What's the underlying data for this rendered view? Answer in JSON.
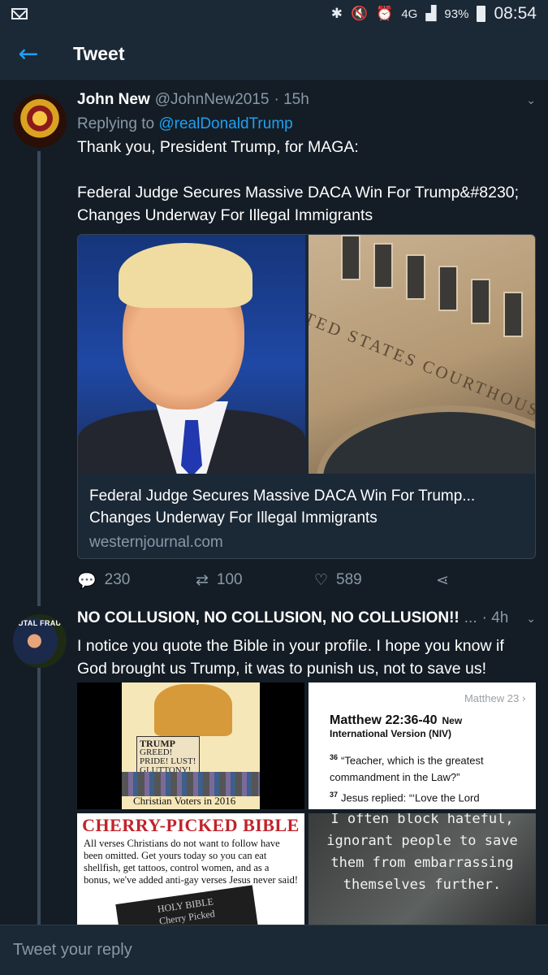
{
  "status_bar": {
    "network": "4G",
    "battery": "93%",
    "time": "08:54"
  },
  "app_bar": {
    "title": "Tweet"
  },
  "main_tweet": {
    "name": "John New",
    "handle": "@JohnNew2015",
    "time": "· 15h",
    "replying_prefix": "Replying to",
    "replying_to": "@realDonaldTrump",
    "text": "Thank you, President Trump, for MAGA:\n\nFederal Judge Secures Massive DACA Win For Trump&#8230; Changes Underway For Illegal Immigrants",
    "card": {
      "image_left_alt": "Donald Trump portrait",
      "image_right_text": "TED STATES COURTHOUSE",
      "title": "Federal Judge Secures Massive DACA Win For Trump... Changes Underway For Illegal Immigrants",
      "domain": "westernjournal.com"
    },
    "actions": {
      "replies": "230",
      "retweets": "100",
      "likes": "589"
    }
  },
  "reply_tweet": {
    "avatar_text": "UTAL FRAU",
    "name": "NO COLLUSION, NO COLLUSION, NO COLLUSION!!",
    "handle_trunc": "...",
    "time": "· 4h",
    "text": "I notice you quote the Bible in your profile. I hope you know if God brought us Trump, it was to punish us, not to save us!",
    "media": {
      "cartoon": {
        "plaque_title": "TRUMP",
        "plaque_text": "GREED! PRIDE! LUST! GLUTTONY!",
        "caption": "Christian Voters in 2016"
      },
      "bible": {
        "nav_label": "Matthew 23",
        "title": "Matthew 22:36-40",
        "title_tag": "New",
        "version": "International Version (NIV)",
        "v36_num": "36",
        "v36_text": "“Teacher, which is the greatest commandment in the Law?”",
        "v37_num": "37",
        "v37_text": "Jesus replied: “‘Love the Lord"
      },
      "cherry": {
        "title": "CHERRY-PICKED BIBLE",
        "text": "All verses Christians do not want to follow have been omitted. Get yours today so you can eat shellfish, get tattoos, control women, and as a bonus, we've added anti-gay verses Jesus never said!",
        "book_label": "HOLY BIBLE\nCherry Picked"
      },
      "quote": "I often block hateful, ignorant people to save them from embarrassing themselves further."
    }
  },
  "composer": {
    "placeholder": "Tweet your reply"
  },
  "colors": {
    "accent": "#1da1f2",
    "bg": "#141d26",
    "bar": "#1b2836",
    "muted": "#8899a6"
  }
}
